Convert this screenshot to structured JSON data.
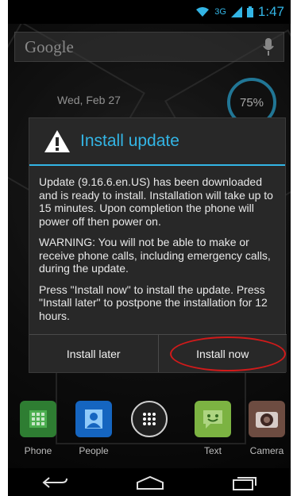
{
  "status_bar": {
    "network_type": "3G",
    "time": "1:47"
  },
  "search": {
    "placeholder": "Google"
  },
  "widgets": {
    "date": "Wed, Feb 27",
    "battery_percent": "75%"
  },
  "dialog": {
    "title": "Install update",
    "paragraphs": [
      "Update (9.16.6.en.US) has been downloaded and is ready to install. Installation will take up to 15 minutes. Upon completion the phone will power off then power on.",
      "WARNING: You will not be able to make or receive phone calls, including emergency calls, during the update.",
      "Press \"Install now\" to install the update. Press \"Install later\" to postpone the installation for 12 hours."
    ],
    "button_later": "Install later",
    "button_now": "Install now"
  },
  "dock": {
    "items": [
      {
        "label": "Phone",
        "icon": "phone-icon"
      },
      {
        "label": "People",
        "icon": "people-icon"
      },
      {
        "label": "",
        "icon": "all-apps-icon"
      },
      {
        "label": "Text",
        "icon": "messaging-icon"
      },
      {
        "label": "Camera",
        "icon": "camera-icon"
      }
    ]
  },
  "colors": {
    "accent": "#33b5e5",
    "annotation": "#d11a1a"
  }
}
